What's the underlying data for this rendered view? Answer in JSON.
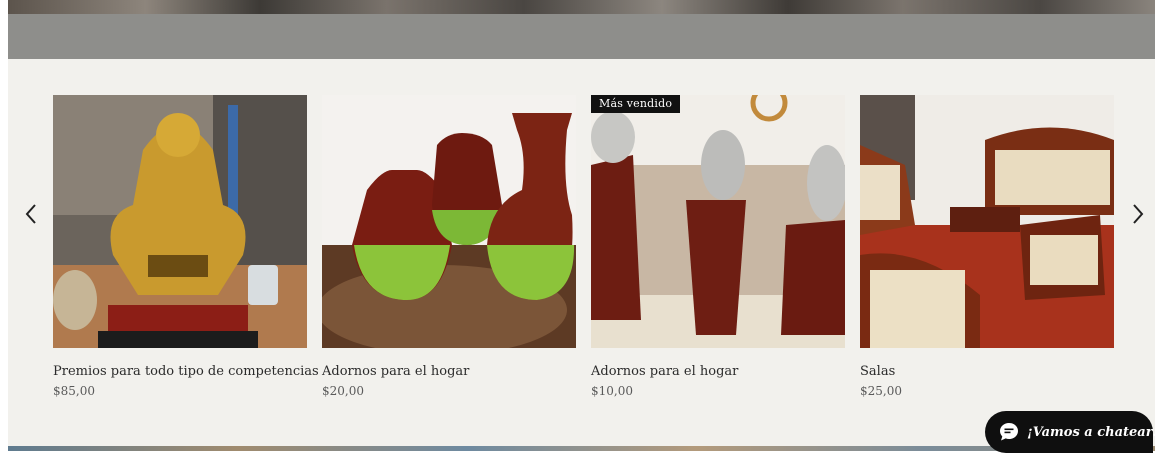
{
  "carousel": {
    "products": [
      {
        "name": "Premios para todo tipo de competencias",
        "price": "$85,00",
        "badge": ""
      },
      {
        "name": "Adornos para el hogar",
        "price": "$20,00",
        "badge": ""
      },
      {
        "name": "Adornos para el hogar",
        "price": "$10,00",
        "badge": "Más vendido"
      },
      {
        "name": "Salas",
        "price": "$25,00",
        "badge": ""
      }
    ]
  },
  "chat": {
    "label": "¡Vamos a chatear!"
  },
  "colors": {
    "carousel_bg": "#f2f1ed",
    "band_gray": "#8e8e8b",
    "chat_bg": "#0f0f0f",
    "text": "#2b2b2b"
  },
  "icons": {
    "prev": "chevron-left-icon",
    "next": "chevron-right-icon",
    "chat": "chat-bubble-icon"
  }
}
